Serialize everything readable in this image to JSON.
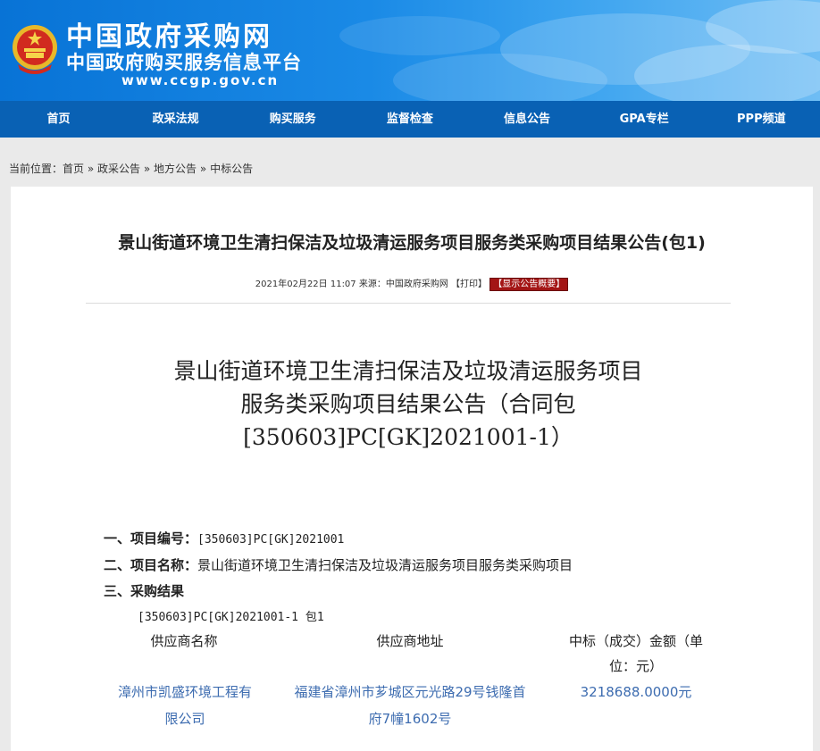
{
  "site": {
    "logo_title": "中国政府采购网",
    "logo_subtitle": "中国政府购买服务信息平台",
    "logo_url": "www.ccgp.gov.cn"
  },
  "nav": {
    "items": [
      {
        "label": "首页"
      },
      {
        "label": "政采法规"
      },
      {
        "label": "购买服务"
      },
      {
        "label": "监督检查"
      },
      {
        "label": "信息公告"
      },
      {
        "label": "GPA专栏"
      },
      {
        "label": "PPP频道"
      }
    ]
  },
  "breadcrumb": {
    "prefix": "当前位置：",
    "items": [
      "首页",
      "政采公告",
      "地方公告",
      "中标公告"
    ],
    "separator": "»"
  },
  "article": {
    "title": "景山街道环境卫生清扫保洁及垃圾清运服务项目服务类采购项目结果公告(包1)",
    "date": "2021年02月22日 11:07",
    "source": "来源：中国政府采购网",
    "print_label": "【打印】",
    "summary_label": "【显示公告概要】",
    "doc_title_lines": [
      "景山街道环境卫生清扫保洁及垃圾清运服务项目",
      "服务类采购项目结果公告（合同包",
      "[350603]PC[GK]2021001-1）"
    ],
    "project_no_label": "一、项目编号：",
    "project_no": "[350603]PC[GK]2021001",
    "project_name_label": "二、项目名称：",
    "project_name": "景山街道环境卫生清扫保洁及垃圾清运服务项目服务类采购项目",
    "result_label": "三、采购结果",
    "package": "[350603]PC[GK]2021001-1 包1",
    "table": {
      "headers": [
        "供应商名称",
        "供应商地址",
        "中标（成交）金额（单位：元）"
      ],
      "header_lines": {
        "amount_1": "中标（成交）金额（单",
        "amount_2": "位：元）"
      },
      "rows": [
        {
          "supplier_1": "漳州市凯盛环境工程有",
          "supplier_2": "限公司",
          "address_1": "福建省漳州市芗城区元光路29号钱隆首",
          "address_2": "府7幢1602号",
          "amount": "3218688.0000元"
        }
      ]
    }
  },
  "colors": {
    "header_blue": "#0873d6",
    "nav_blue": "#0961b4",
    "link_blue": "#3d6cb0",
    "summary_red": "#a31515"
  }
}
